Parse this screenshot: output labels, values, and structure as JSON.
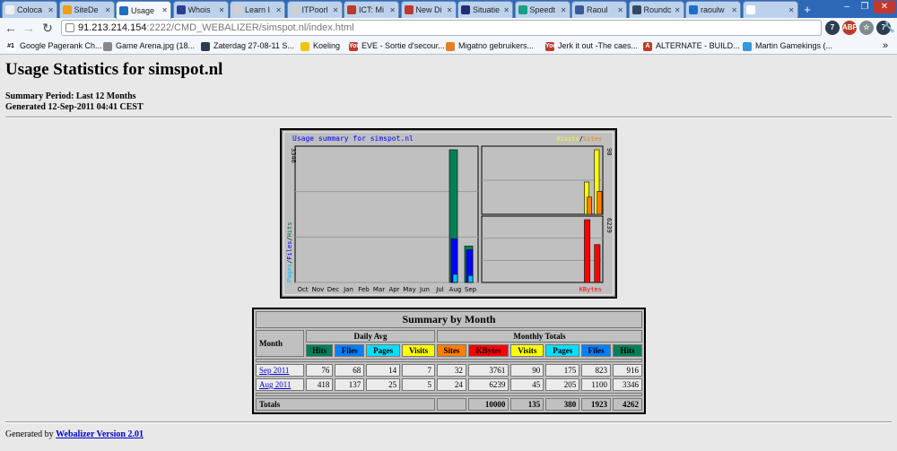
{
  "browser": {
    "tabs": [
      {
        "label": "Coloca",
        "icon_color": "#f0f0f0"
      },
      {
        "label": "SiteDe",
        "icon_color": "#f39c12"
      },
      {
        "label": "Usage",
        "icon_color": "#1f6fc5",
        "active": true
      },
      {
        "label": "Whois",
        "icon_color": "#2c3e8f"
      },
      {
        "label": "Learn I",
        "icon_color": "#d0d0d0"
      },
      {
        "label": "ITPoorl",
        "icon_color": "#d0d0d0"
      },
      {
        "label": "ICT: Mi",
        "icon_color": "#c0392b"
      },
      {
        "label": "New Di",
        "icon_color": "#c0392b"
      },
      {
        "label": "Situatie",
        "icon_color": "#1f2f70"
      },
      {
        "label": "Speedt",
        "icon_color": "#16a085"
      },
      {
        "label": "Raoul",
        "icon_color": "#3b5998"
      },
      {
        "label": "Roundc",
        "icon_color": "#34495e"
      },
      {
        "label": "raoulw",
        "icon_color": "#1f6fc5"
      },
      {
        "label": "",
        "icon_color": "#ffffff"
      }
    ],
    "new_tab": "+",
    "window_controls": [
      "‒",
      "❐",
      "✕"
    ],
    "url_host": "91.213.214.154",
    "url_path": ":2222/CMD_WEBALIZER/simspot.nl/index.html",
    "extensions": [
      {
        "label": "7",
        "color": "#2c3e50"
      },
      {
        "label": "ABP",
        "color": "#c0392b"
      },
      {
        "label": "☆",
        "color": "#7f8c8d"
      },
      {
        "label": "7",
        "color": "#2c3e50"
      },
      {
        "label": "🔧",
        "color": "#7f8c8d"
      }
    ],
    "bookmarks": [
      {
        "label": "Google Pagerank Ch...",
        "icon": "#1",
        "icon_color": "#ffffff",
        "text_color": "#000"
      },
      {
        "label": "Game Arena.jpg (18...",
        "icon": "",
        "icon_color": "#888888"
      },
      {
        "label": "Zaterdag 27-08-11 S...",
        "icon": "",
        "icon_color": "#2c3e50"
      },
      {
        "label": "Koeling",
        "icon": "",
        "icon_color": "#f1c40f"
      },
      {
        "label": "EVE - Sortie d'secour...",
        "icon": "You",
        "icon_color": "#c0392b"
      },
      {
        "label": "Migatno gebruikers...",
        "icon": "",
        "icon_color": "#e67e22"
      },
      {
        "label": "Jerk it out -The caes...",
        "icon": "You",
        "icon_color": "#c0392b"
      },
      {
        "label": "ALTERNATE - BUILD...",
        "icon": "A",
        "icon_color": "#c0392b"
      },
      {
        "label": "Martin Gamekings (...",
        "icon": "",
        "icon_color": "#3498db"
      }
    ],
    "more_bookmarks": "»"
  },
  "page": {
    "title": "Usage Statistics for simspot.nl",
    "summary_period": "Summary Period: Last 12 Months",
    "generated": "Generated 12-Sep-2011 04:41 CEST",
    "footer_prefix": "Generated by ",
    "footer_link": "Webalizer Version 2.01"
  },
  "chart_data": {
    "type": "bar",
    "title": "Usage summary for simspot.nl",
    "categories": [
      "Oct",
      "Nov",
      "Dec",
      "Jan",
      "Feb",
      "Mar",
      "Apr",
      "May",
      "Jun",
      "Jul",
      "Aug",
      "Sep"
    ],
    "left_panel": {
      "ylabel_parts": [
        {
          "text": "Pages",
          "color": "#00c0ff"
        },
        {
          "text": "/",
          "color": "#000000"
        },
        {
          "text": "Files",
          "color": "#0000ff"
        },
        {
          "text": "/",
          "color": "#000000"
        },
        {
          "text": "Hits",
          "color": "#006b46"
        }
      ],
      "ymax_label": "3346",
      "ymax": 3346,
      "series": [
        {
          "name": "Hits",
          "color": "#00805a",
          "values": [
            0,
            0,
            0,
            0,
            0,
            0,
            0,
            0,
            0,
            0,
            3346,
            916
          ]
        },
        {
          "name": "Files",
          "color": "#0000ff",
          "values": [
            0,
            0,
            0,
            0,
            0,
            0,
            0,
            0,
            0,
            0,
            1100,
            823
          ]
        },
        {
          "name": "Pages",
          "color": "#00c0ff",
          "values": [
            0,
            0,
            0,
            0,
            0,
            0,
            0,
            0,
            0,
            0,
            205,
            175
          ]
        }
      ]
    },
    "top_right_panel": {
      "legend_parts": [
        {
          "text": "Visits",
          "color": "#ffff00"
        },
        {
          "text": "/",
          "color": "#000000"
        },
        {
          "text": "Sites",
          "color": "#ff8000"
        }
      ],
      "ymax_label": "90",
      "ymax": 90,
      "series": [
        {
          "name": "Visits",
          "color": "#ffff00",
          "values": [
            0,
            0,
            0,
            0,
            0,
            0,
            0,
            0,
            0,
            0,
            45,
            90
          ]
        },
        {
          "name": "Sites",
          "color": "#ff8000",
          "values": [
            0,
            0,
            0,
            0,
            0,
            0,
            0,
            0,
            0,
            0,
            24,
            32
          ]
        }
      ]
    },
    "bottom_right_panel": {
      "legend": {
        "text": "KBytes",
        "color": "#ff0000"
      },
      "ymax_label": "6239",
      "ymax": 6239,
      "series": [
        {
          "name": "KBytes",
          "color": "#ff0000",
          "values": [
            0,
            0,
            0,
            0,
            0,
            0,
            0,
            0,
            0,
            0,
            6239,
            3761
          ]
        }
      ]
    }
  },
  "summary": {
    "title": "Summary by Month",
    "month_header": "Month",
    "daily_avg_header": "Daily Avg",
    "monthly_totals_header": "Monthly Totals",
    "daily_cols": [
      {
        "label": "Hits",
        "bg": "#00805a",
        "fg": "#000"
      },
      {
        "label": "Files",
        "bg": "#0080ff",
        "fg": "#000"
      },
      {
        "label": "Pages",
        "bg": "#00e0ff",
        "fg": "#000"
      },
      {
        "label": "Visits",
        "bg": "#ffff00",
        "fg": "#000"
      }
    ],
    "monthly_cols": [
      {
        "label": "Sites",
        "bg": "#ff8000",
        "fg": "#000"
      },
      {
        "label": "KBytes",
        "bg": "#ff0000",
        "fg": "#000"
      },
      {
        "label": "Visits",
        "bg": "#ffff00",
        "fg": "#000"
      },
      {
        "label": "Pages",
        "bg": "#00e0ff",
        "fg": "#000"
      },
      {
        "label": "Files",
        "bg": "#0080ff",
        "fg": "#000"
      },
      {
        "label": "Hits",
        "bg": "#00805a",
        "fg": "#000"
      }
    ],
    "rows": [
      {
        "month": "Sep 2011",
        "values": [
          "76",
          "68",
          "14",
          "7",
          "32",
          "3761",
          "90",
          "175",
          "823",
          "916"
        ]
      },
      {
        "month": "Aug 2011",
        "values": [
          "418",
          "137",
          "25",
          "5",
          "24",
          "6239",
          "45",
          "205",
          "1100",
          "3346"
        ]
      }
    ],
    "totals_label": "Totals",
    "totals": [
      "10000",
      "135",
      "380",
      "1923",
      "4262"
    ]
  }
}
